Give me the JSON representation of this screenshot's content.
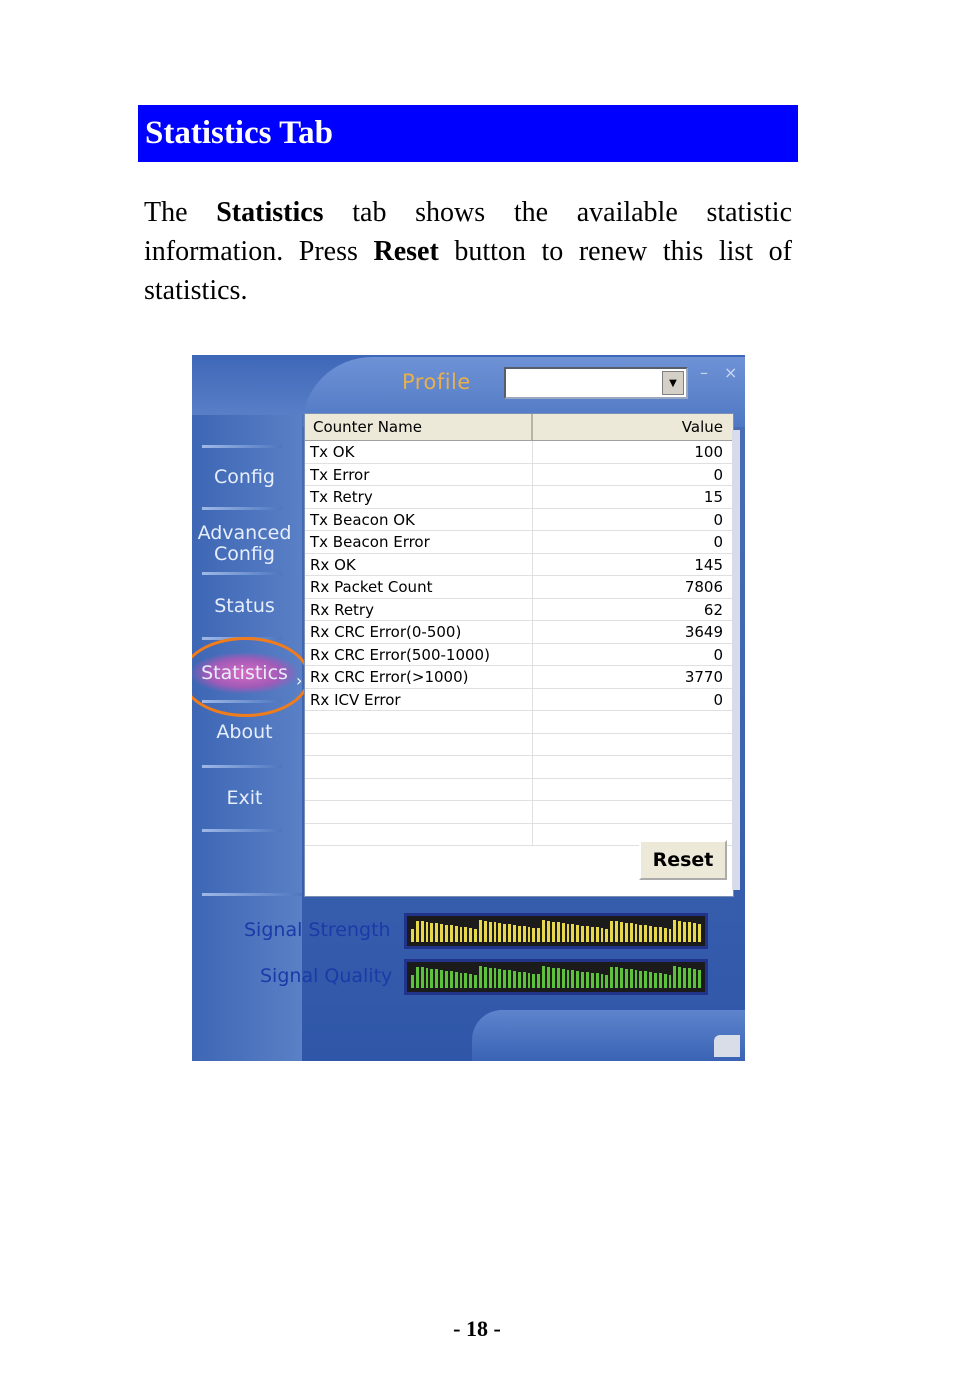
{
  "section": {
    "title": "Statistics Tab",
    "intro_1": "The ",
    "intro_bold_1": "Statistics",
    "intro_2": " tab shows the available statistic information. Press ",
    "intro_bold_2": "Reset",
    "intro_3": " button to renew this list of statistics."
  },
  "app": {
    "profile_label": "Profile",
    "profile_value": "",
    "window_controls": [
      "–",
      "×"
    ],
    "nav": [
      {
        "label": "Config"
      },
      {
        "label": "Advanced Config"
      },
      {
        "label": "Status"
      },
      {
        "label": "Statistics"
      },
      {
        "label": "About"
      },
      {
        "label": "Exit"
      }
    ],
    "active_nav": "Statistics",
    "table": {
      "headers": [
        "Counter Name",
        "Value"
      ],
      "rows": [
        [
          "Tx OK",
          "100"
        ],
        [
          "Tx Error",
          "0"
        ],
        [
          "Tx Retry",
          "15"
        ],
        [
          "Tx Beacon OK",
          "0"
        ],
        [
          "Tx Beacon Error",
          "0"
        ],
        [
          "Rx OK",
          "145"
        ],
        [
          "Rx Packet Count",
          "7806"
        ],
        [
          "Rx Retry",
          "62"
        ],
        [
          "Rx CRC Error(0-500)",
          "3649"
        ],
        [
          "Rx CRC Error(500-1000)",
          "0"
        ],
        [
          "Rx CRC Error(>1000)",
          "3770"
        ],
        [
          "Rx ICV Error",
          "0"
        ]
      ]
    },
    "reset_label": "Reset",
    "signal_strength_label": "Signal Strength",
    "signal_quality_label": "Signal Quality",
    "colors": {
      "strength_bar": "#e6d84a",
      "quality_bar": "#5cc23a",
      "header_blue": "#0000ff"
    }
  },
  "page_number": "- 18 -"
}
